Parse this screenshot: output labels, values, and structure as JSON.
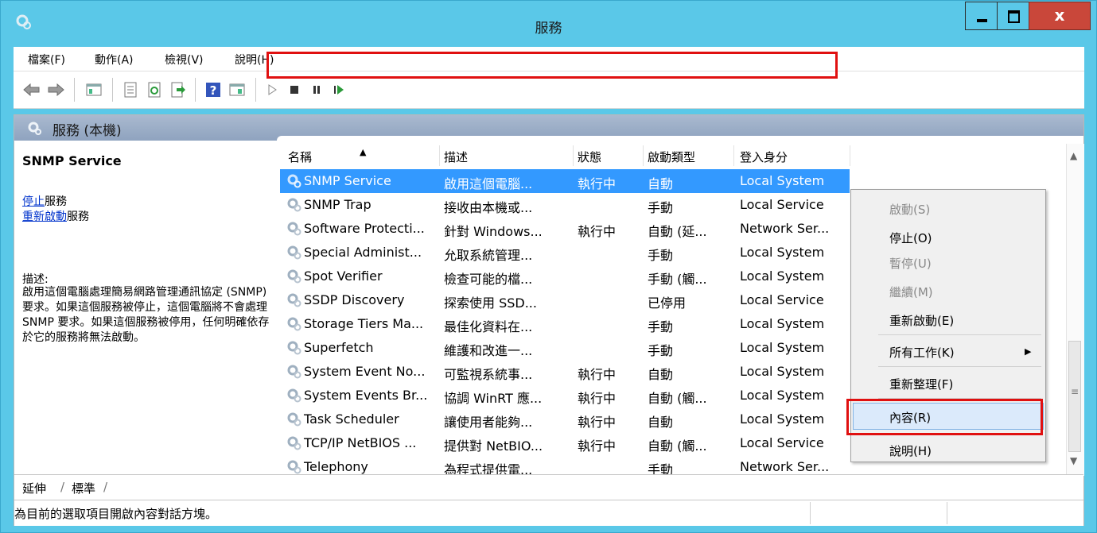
{
  "window": {
    "title": "服務"
  },
  "menu": [
    "檔案(F)",
    "動作(A)",
    "檢視(V)",
    "說明(H)"
  ],
  "toolbar_icons": [
    "back-arrow-icon",
    "forward-arrow-icon",
    "console-tree-icon",
    "properties-icon",
    "refresh-icon",
    "export-list-icon",
    "help-icon",
    "show-hide-icon",
    "start-service-icon",
    "stop-service-icon",
    "pause-service-icon",
    "resume-service-icon"
  ],
  "header": {
    "title": "服務 (本機)"
  },
  "left": {
    "service_name": "SNMP Service",
    "stop_link": "停止",
    "stop_suffix": "服務",
    "restart_link": "重新啟動",
    "restart_suffix": "服務",
    "desc_label": "描述:",
    "desc_text": "啟用這個電腦處理簡易網路管理通訊協定 (SNMP) 要求。如果這個服務被停止，這個電腦將不會處理 SNMP 要求。如果這個服務被停用，任何明確依存於它的服務將無法啟動。"
  },
  "columns": [
    "名稱",
    "描述",
    "狀態",
    "啟動類型",
    "登入身分"
  ],
  "rows": [
    {
      "name": "SNMP Service",
      "desc": "啟用這個電腦...",
      "status": "執行中",
      "startup": "自動",
      "logon": "Local System",
      "selected": true
    },
    {
      "name": "SNMP Trap",
      "desc": "接收由本機或...",
      "status": "",
      "startup": "手動",
      "logon": "Local Service"
    },
    {
      "name": "Software Protecti...",
      "desc": "針對 Windows...",
      "status": "執行中",
      "startup": "自動 (延...",
      "logon": "Network Ser..."
    },
    {
      "name": "Special Administ...",
      "desc": "允取系統管理...",
      "status": "",
      "startup": "手動",
      "logon": "Local System"
    },
    {
      "name": "Spot Verifier",
      "desc": "檢查可能的檔...",
      "status": "",
      "startup": "手動 (觸...",
      "logon": "Local System"
    },
    {
      "name": "SSDP Discovery",
      "desc": "探索使用 SSD...",
      "status": "",
      "startup": "已停用",
      "logon": "Local Service"
    },
    {
      "name": "Storage Tiers Ma...",
      "desc": "最佳化資料在...",
      "status": "",
      "startup": "手動",
      "logon": "Local System"
    },
    {
      "name": "Superfetch",
      "desc": "維護和改進一...",
      "status": "",
      "startup": "手動",
      "logon": "Local System"
    },
    {
      "name": "System Event No...",
      "desc": "可監視系統事...",
      "status": "執行中",
      "startup": "自動",
      "logon": "Local System"
    },
    {
      "name": "System Events Br...",
      "desc": "協調 WinRT 應...",
      "status": "執行中",
      "startup": "自動 (觸...",
      "logon": "Local System"
    },
    {
      "name": "Task Scheduler",
      "desc": "讓使用者能夠...",
      "status": "執行中",
      "startup": "自動",
      "logon": "Local System"
    },
    {
      "name": "TCP/IP NetBIOS ...",
      "desc": "提供對 NetBIO...",
      "status": "執行中",
      "startup": "自動 (觸...",
      "logon": "Local Service"
    },
    {
      "name": "Telephony",
      "desc": "為程式提供電...",
      "status": "",
      "startup": "手動",
      "logon": "Network Ser..."
    }
  ],
  "context_menu": {
    "start": "啟動(S)",
    "stop": "停止(O)",
    "pause": "暫停(U)",
    "resume": "繼續(M)",
    "restart": "重新啟動(E)",
    "all_tasks": "所有工作(K)",
    "refresh": "重新整理(F)",
    "properties": "內容(R)",
    "help": "說明(H)"
  },
  "tabs": [
    "延伸",
    "標準"
  ],
  "status": {
    "text": "為目前的選取項目開啟內容對話方塊。"
  }
}
